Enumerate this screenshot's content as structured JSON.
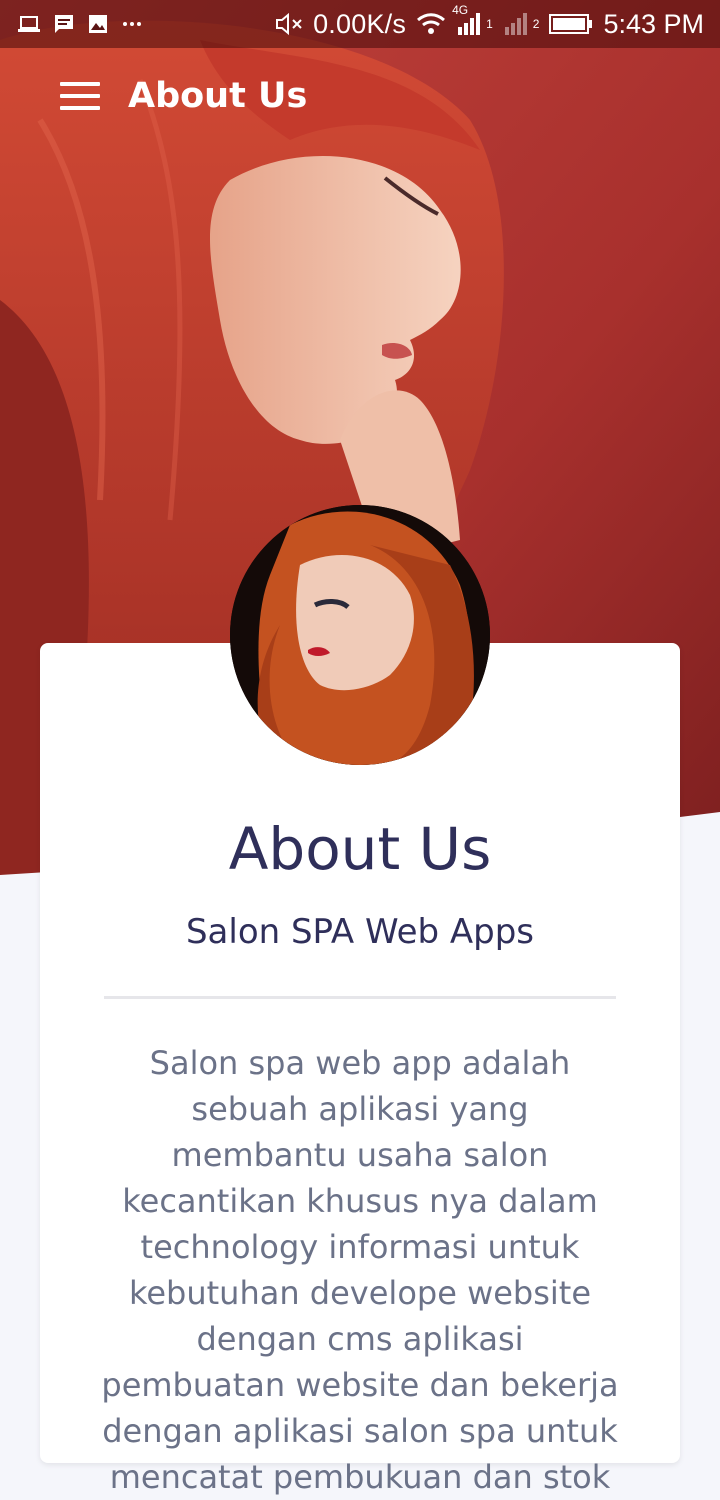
{
  "status_bar": {
    "network_speed": "0.00K/s",
    "network_type": "4G",
    "sim1": "1",
    "sim2": "2",
    "time": "5:43 PM",
    "icons": [
      "laptop-icon",
      "message-icon",
      "image-icon",
      "more-icon",
      "mute-icon",
      "wifi-icon",
      "signal-icon",
      "battery-icon"
    ]
  },
  "appbar": {
    "title": "About Us",
    "menu_icon": "hamburger-menu-icon"
  },
  "card": {
    "title": "About Us",
    "subtitle": "Salon SPA Web Apps",
    "body": "Salon spa web app adalah sebuah aplikasi yang membantu usaha salon kecantikan khusus nya dalam technology informasi untuk kebutuhan develope website dengan cms aplikasi pembuatan website dan bekerja dengan aplikasi salon spa untuk mencatat pembukuan dan stok"
  },
  "colors": {
    "hero_red": "#b23a34",
    "title_color": "#2f2f5a",
    "body_color": "#6b7288",
    "page_bg": "#f5f6fb"
  }
}
